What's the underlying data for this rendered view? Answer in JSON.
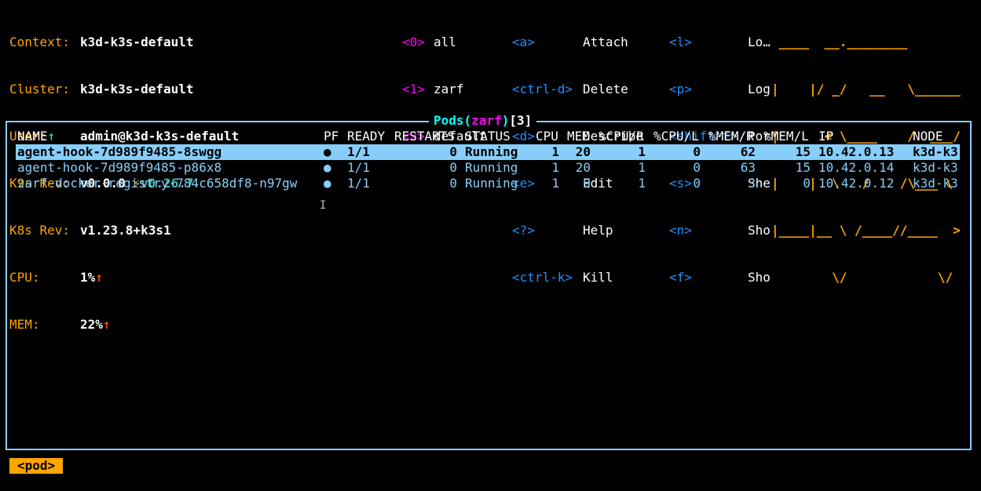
{
  "context": {
    "labels": [
      "Context:",
      "Cluster:",
      "User:",
      "K9s Rev:",
      "K8s Rev:",
      "CPU:",
      "MEM:"
    ],
    "context": "k3d-k3s-default",
    "cluster": "k3d-k3s-default",
    "user": "admin@k3d-k3s-default",
    "k9s_rev": "v0.0.0",
    "k9s_upgrade_icon": "⚡",
    "k9s_upgrade": "v0.26.7",
    "k8s_rev": "v1.23.8+k3s1",
    "cpu": "1%",
    "mem": "22%",
    "trend_icon": "↑"
  },
  "namespaces": [
    {
      "key": "<0>",
      "name": "all"
    },
    {
      "key": "<1>",
      "name": "zarf"
    },
    {
      "key": "<2>",
      "name": "default"
    }
  ],
  "hotkeys_col1": [
    {
      "key": "<a>",
      "action": "Attach"
    },
    {
      "key": "<ctrl-d>",
      "action": "Delete"
    },
    {
      "key": "<d>",
      "action": "Describe"
    },
    {
      "key": "<e>",
      "action": "Edit"
    },
    {
      "key": "<?>",
      "action": "Help"
    },
    {
      "key": "<ctrl-k>",
      "action": "Kill"
    }
  ],
  "hotkeys_col2": [
    {
      "key": "<l>",
      "action": "Lo…"
    },
    {
      "key": "<p>",
      "action": "Log"
    },
    {
      "key": "<shift-f>",
      "action": "Por"
    },
    {
      "key": "<s>",
      "action": "She"
    },
    {
      "key": "<n>",
      "action": "Sho"
    },
    {
      "key": "<f>",
      "action": "Sho"
    }
  ],
  "logo_lines": [
    " ____  __.________",
    "|    |/ _/   __   \\______",
    "|      < \\____    /  ___/",
    "|    |  \\   /    /\\___ \\",
    "|____|__ \\ /____//____  >",
    "        \\/            \\/"
  ],
  "table": {
    "title": "Pods",
    "namespace": "zarf",
    "count": "3",
    "sort_icon": "↑",
    "headers": {
      "name": "NAME",
      "pf": "PF",
      "ready": "READY",
      "restarts": "RESTARTS",
      "status": "STATUS",
      "cpu": "CPU",
      "mem": "MEM",
      "cpu_r": "%CPU/R",
      "cpu_l": "%CPU/L",
      "mem_r": "%MEM/R",
      "mem_l": "%MEM/L",
      "ip": "IP",
      "node": "NODE"
    },
    "rows": [
      {
        "name": "agent-hook-7d989f9485-8swgg",
        "pf": "●",
        "ready": "1/1",
        "restarts": "0",
        "status": "Running",
        "cpu": "1",
        "mem": "20",
        "cpu_r": "1",
        "cpu_l": "0",
        "mem_r": "62",
        "mem_l": "15",
        "ip": "10.42.0.13",
        "node": "k3d-k3"
      },
      {
        "name": "agent-hook-7d989f9485-p86x8",
        "pf": "●",
        "ready": "1/1",
        "restarts": "0",
        "status": "Running",
        "cpu": "1",
        "mem": "20",
        "cpu_r": "1",
        "cpu_l": "0",
        "mem_r": "63",
        "mem_l": "15",
        "ip": "10.42.0.14",
        "node": "k3d-k3"
      },
      {
        "name": "zarf-docker-registry-784c658df8-n97gw",
        "pf": "●",
        "ready": "1/1",
        "restarts": "0",
        "status": "Running",
        "cpu": "1",
        "mem": "9",
        "cpu_r": "1",
        "cpu_l": "0",
        "mem_r": "3",
        "mem_l": "0",
        "ip": "10.42.0.12",
        "node": "k3d-k3"
      }
    ]
  },
  "breadcrumb": "<pod>",
  "cursor_icon": "I"
}
